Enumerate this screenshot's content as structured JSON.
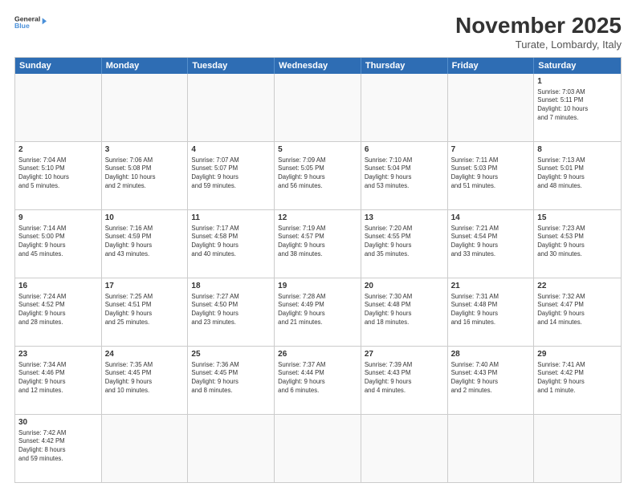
{
  "header": {
    "logo_general": "General",
    "logo_blue": "Blue",
    "month_title": "November 2025",
    "subtitle": "Turate, Lombardy, Italy"
  },
  "weekdays": [
    "Sunday",
    "Monday",
    "Tuesday",
    "Wednesday",
    "Thursday",
    "Friday",
    "Saturday"
  ],
  "rows": [
    [
      {
        "num": "",
        "info": ""
      },
      {
        "num": "",
        "info": ""
      },
      {
        "num": "",
        "info": ""
      },
      {
        "num": "",
        "info": ""
      },
      {
        "num": "",
        "info": ""
      },
      {
        "num": "",
        "info": ""
      },
      {
        "num": "1",
        "info": "Sunrise: 7:03 AM\nSunset: 5:11 PM\nDaylight: 10 hours\nand 7 minutes."
      }
    ],
    [
      {
        "num": "2",
        "info": "Sunrise: 7:04 AM\nSunset: 5:10 PM\nDaylight: 10 hours\nand 5 minutes."
      },
      {
        "num": "3",
        "info": "Sunrise: 7:06 AM\nSunset: 5:08 PM\nDaylight: 10 hours\nand 2 minutes."
      },
      {
        "num": "4",
        "info": "Sunrise: 7:07 AM\nSunset: 5:07 PM\nDaylight: 9 hours\nand 59 minutes."
      },
      {
        "num": "5",
        "info": "Sunrise: 7:09 AM\nSunset: 5:05 PM\nDaylight: 9 hours\nand 56 minutes."
      },
      {
        "num": "6",
        "info": "Sunrise: 7:10 AM\nSunset: 5:04 PM\nDaylight: 9 hours\nand 53 minutes."
      },
      {
        "num": "7",
        "info": "Sunrise: 7:11 AM\nSunset: 5:03 PM\nDaylight: 9 hours\nand 51 minutes."
      },
      {
        "num": "8",
        "info": "Sunrise: 7:13 AM\nSunset: 5:01 PM\nDaylight: 9 hours\nand 48 minutes."
      }
    ],
    [
      {
        "num": "9",
        "info": "Sunrise: 7:14 AM\nSunset: 5:00 PM\nDaylight: 9 hours\nand 45 minutes."
      },
      {
        "num": "10",
        "info": "Sunrise: 7:16 AM\nSunset: 4:59 PM\nDaylight: 9 hours\nand 43 minutes."
      },
      {
        "num": "11",
        "info": "Sunrise: 7:17 AM\nSunset: 4:58 PM\nDaylight: 9 hours\nand 40 minutes."
      },
      {
        "num": "12",
        "info": "Sunrise: 7:19 AM\nSunset: 4:57 PM\nDaylight: 9 hours\nand 38 minutes."
      },
      {
        "num": "13",
        "info": "Sunrise: 7:20 AM\nSunset: 4:55 PM\nDaylight: 9 hours\nand 35 minutes."
      },
      {
        "num": "14",
        "info": "Sunrise: 7:21 AM\nSunset: 4:54 PM\nDaylight: 9 hours\nand 33 minutes."
      },
      {
        "num": "15",
        "info": "Sunrise: 7:23 AM\nSunset: 4:53 PM\nDaylight: 9 hours\nand 30 minutes."
      }
    ],
    [
      {
        "num": "16",
        "info": "Sunrise: 7:24 AM\nSunset: 4:52 PM\nDaylight: 9 hours\nand 28 minutes."
      },
      {
        "num": "17",
        "info": "Sunrise: 7:25 AM\nSunset: 4:51 PM\nDaylight: 9 hours\nand 25 minutes."
      },
      {
        "num": "18",
        "info": "Sunrise: 7:27 AM\nSunset: 4:50 PM\nDaylight: 9 hours\nand 23 minutes."
      },
      {
        "num": "19",
        "info": "Sunrise: 7:28 AM\nSunset: 4:49 PM\nDaylight: 9 hours\nand 21 minutes."
      },
      {
        "num": "20",
        "info": "Sunrise: 7:30 AM\nSunset: 4:48 PM\nDaylight: 9 hours\nand 18 minutes."
      },
      {
        "num": "21",
        "info": "Sunrise: 7:31 AM\nSunset: 4:48 PM\nDaylight: 9 hours\nand 16 minutes."
      },
      {
        "num": "22",
        "info": "Sunrise: 7:32 AM\nSunset: 4:47 PM\nDaylight: 9 hours\nand 14 minutes."
      }
    ],
    [
      {
        "num": "23",
        "info": "Sunrise: 7:34 AM\nSunset: 4:46 PM\nDaylight: 9 hours\nand 12 minutes."
      },
      {
        "num": "24",
        "info": "Sunrise: 7:35 AM\nSunset: 4:45 PM\nDaylight: 9 hours\nand 10 minutes."
      },
      {
        "num": "25",
        "info": "Sunrise: 7:36 AM\nSunset: 4:45 PM\nDaylight: 9 hours\nand 8 minutes."
      },
      {
        "num": "26",
        "info": "Sunrise: 7:37 AM\nSunset: 4:44 PM\nDaylight: 9 hours\nand 6 minutes."
      },
      {
        "num": "27",
        "info": "Sunrise: 7:39 AM\nSunset: 4:43 PM\nDaylight: 9 hours\nand 4 minutes."
      },
      {
        "num": "28",
        "info": "Sunrise: 7:40 AM\nSunset: 4:43 PM\nDaylight: 9 hours\nand 2 minutes."
      },
      {
        "num": "29",
        "info": "Sunrise: 7:41 AM\nSunset: 4:42 PM\nDaylight: 9 hours\nand 1 minute."
      }
    ],
    [
      {
        "num": "30",
        "info": "Sunrise: 7:42 AM\nSunset: 4:42 PM\nDaylight: 8 hours\nand 59 minutes."
      },
      {
        "num": "",
        "info": ""
      },
      {
        "num": "",
        "info": ""
      },
      {
        "num": "",
        "info": ""
      },
      {
        "num": "",
        "info": ""
      },
      {
        "num": "",
        "info": ""
      },
      {
        "num": "",
        "info": ""
      }
    ]
  ]
}
